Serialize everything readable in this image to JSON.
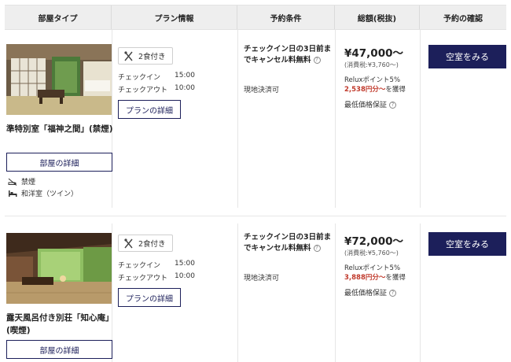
{
  "table": {
    "headers": [
      "部屋タイプ",
      "プラン情報",
      "予約条件",
      "総額(税抜)",
      "予約の確認"
    ]
  },
  "rooms": [
    {
      "name": "準特別室「福神之間」(禁煙)",
      "room_detail_label": "部屋の詳細",
      "attributes": [
        {
          "icon": "no-smoking-icon",
          "label": "禁煙"
        },
        {
          "icon": "bed-icon",
          "label": "和洋室（ツイン）"
        }
      ],
      "plan": {
        "meal_label": "2食付き",
        "checkin_label": "チェックイン",
        "checkin_time": "15:00",
        "checkout_label": "チェックアウト",
        "checkout_time": "10:00",
        "plan_detail_label": "プランの詳細"
      },
      "conditions": {
        "cancel_text": "チェックイン日の3日前までキャンセル料無料",
        "payment": "現地決済可"
      },
      "price": {
        "total": "¥47,000〜",
        "tax": "(消費税:¥3,760〜)",
        "points": "Reluxポイント5%",
        "earn_amount": "2,538円分〜",
        "earn_suffix": "を獲得",
        "guarantee": "最低価格保証"
      },
      "action_label": "空室をみる"
    },
    {
      "name": "露天風呂付き別荘「知心庵」(喫煙)",
      "room_detail_label": "部屋の詳細",
      "attributes": [],
      "plan": {
        "meal_label": "2食付き",
        "checkin_label": "チェックイン",
        "checkin_time": "15:00",
        "checkout_label": "チェックアウト",
        "checkout_time": "10:00",
        "plan_detail_label": "プランの詳細"
      },
      "conditions": {
        "cancel_text": "チェックイン日の3日前までキャンセル料無料",
        "payment": "現地決済可"
      },
      "price": {
        "total": "¥72,000〜",
        "tax": "(消費税:¥5,760〜)",
        "points": "Reluxポイント5%",
        "earn_amount": "3,888円分〜",
        "earn_suffix": "を獲得",
        "guarantee": "最低価格保証"
      },
      "action_label": "空室をみる"
    }
  ],
  "colors": {
    "navy": "#1c1f5a",
    "earn_red": "#c0392b",
    "header_bg": "#eeeeee"
  }
}
